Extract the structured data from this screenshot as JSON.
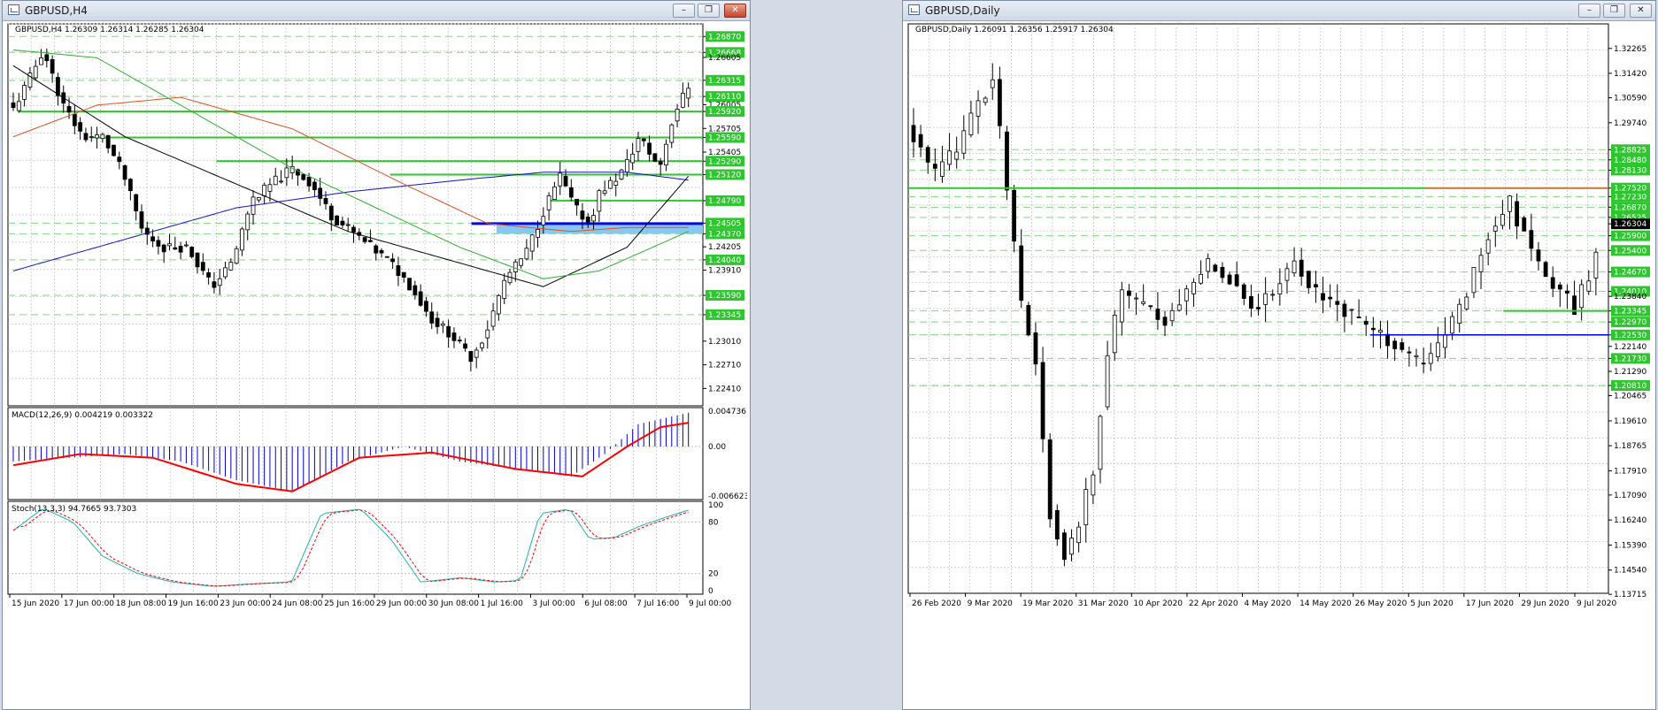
{
  "colors": {
    "bull": "#ffffff",
    "bear": "#000000",
    "grid": "#c0c0c0",
    "green_level": "#2ec62e",
    "dash_level": "#7fd97f",
    "blue": "#0000ff",
    "macd_hist": "#0000cc",
    "macd_signal": "#ff0000",
    "stoch_main": "#20b2aa",
    "stoch_signal": "#ff0000",
    "ma_black": "#000000",
    "ma_blue": "#1010cc",
    "ma_red": "#e05020",
    "ma_green": "#30b030",
    "zone": "#88c8f0",
    "brown": "#c87832"
  },
  "left": {
    "title": "GBPUSD,H4",
    "header": "GBPUSD,H4  1.26309 1.26314 1.26285 1.26304",
    "yrange": [
      1.2219,
      1.2703
    ],
    "yticks": [
      {
        "v": 1.2687,
        "label": "1.26870",
        "hl": true
      },
      {
        "v": 1.26668,
        "label": "1.26668",
        "hl": true
      },
      {
        "v": 1.26605,
        "label": "1.26605",
        "hl": false
      },
      {
        "v": 1.26315,
        "label": "1.26315",
        "hl": true
      },
      {
        "v": 1.2611,
        "label": "1.26110",
        "hl": true
      },
      {
        "v": 1.26005,
        "label": "1.26005",
        "hl": false
      },
      {
        "v": 1.2592,
        "label": "1.25920",
        "hl": true
      },
      {
        "v": 1.25705,
        "label": "1.25705",
        "hl": false
      },
      {
        "v": 1.2559,
        "label": "1.25590",
        "hl": true
      },
      {
        "v": 1.25405,
        "label": "1.25405",
        "hl": false
      },
      {
        "v": 1.2529,
        "label": "1.25290",
        "hl": true
      },
      {
        "v": 1.2512,
        "label": "1.25120",
        "hl": true
      },
      {
        "v": 1.2479,
        "label": "1.24790",
        "hl": true
      },
      {
        "v": 1.24505,
        "label": "1.24505",
        "hl": true
      },
      {
        "v": 1.2437,
        "label": "1.24370",
        "hl": true
      },
      {
        "v": 1.24205,
        "label": "1.24205",
        "hl": false
      },
      {
        "v": 1.2404,
        "label": "1.24040",
        "hl": true
      },
      {
        "v": 1.2391,
        "label": "1.23910",
        "hl": false
      },
      {
        "v": 1.2359,
        "label": "1.23590",
        "hl": true
      },
      {
        "v": 1.23345,
        "label": "1.23345",
        "hl": true
      },
      {
        "v": 1.2301,
        "label": "1.23010",
        "hl": false
      },
      {
        "v": 1.2271,
        "label": "1.22710",
        "hl": false
      },
      {
        "v": 1.2241,
        "label": "1.22410",
        "hl": false
      }
    ],
    "solid_levels": [
      1.2592,
      1.2559,
      1.2529,
      1.2512,
      1.2479
    ],
    "dashed_levels": [
      1.2687,
      1.26668,
      1.26315,
      1.2611,
      1.24505,
      1.2437,
      1.2404,
      1.2359,
      1.23345
    ],
    "blue_level": 1.245,
    "zone": [
      1.2437,
      1.245
    ],
    "xlabels": [
      "15 Jun 2020",
      "17 Jun 00:00",
      "18 Jun 08:00",
      "19 Jun 16:00",
      "23 Jun 00:00",
      "24 Jun 08:00",
      "25 Jun 16:00",
      "29 Jun 00:00",
      "30 Jun 08:00",
      "1 Jul 16:00",
      "3 Jul 00:00",
      "6 Jul 08:00",
      "7 Jul 16:00",
      "9 Jul 00:00"
    ],
    "macd": {
      "header": "MACD(12,26,9) 0.004219 0.003322",
      "range": [
        -0.006623,
        0.004736
      ],
      "ticks": [
        "0.004736",
        "0.00",
        "-0.006623"
      ]
    },
    "stoch": {
      "header": "Stoch(13,3,3) 94.7665 93.7303",
      "ticks": [
        "100",
        "80",
        "20",
        "0"
      ]
    }
  },
  "right": {
    "title": "GBPUSD,Daily",
    "header": "GBPUSD,Daily  1.26091 1.26356 1.25917 1.26304",
    "yrange": [
      1.1375,
      1.331
    ],
    "yticks": [
      {
        "v": 1.32265,
        "label": "1.32265",
        "hl": false
      },
      {
        "v": 1.3142,
        "label": "1.31420",
        "hl": false
      },
      {
        "v": 1.3059,
        "label": "1.30590",
        "hl": false
      },
      {
        "v": 1.2974,
        "label": "1.29740",
        "hl": false
      },
      {
        "v": 1.28825,
        "label": "1.28825",
        "hl": true
      },
      {
        "v": 1.2848,
        "label": "1.28480",
        "hl": true
      },
      {
        "v": 1.2813,
        "label": "1.28130",
        "hl": true
      },
      {
        "v": 1.2752,
        "label": "1.27520",
        "hl": true
      },
      {
        "v": 1.2723,
        "label": "1.27230",
        "hl": true
      },
      {
        "v": 1.2687,
        "label": "1.26870",
        "hl": true
      },
      {
        "v": 1.26525,
        "label": "1.26525",
        "hl": true
      },
      {
        "v": 1.26304,
        "label": "1.26304",
        "hl": false,
        "cur": true
      },
      {
        "v": 1.259,
        "label": "1.25900",
        "hl": true
      },
      {
        "v": 1.254,
        "label": "1.25400",
        "hl": true
      },
      {
        "v": 1.2467,
        "label": "1.24670",
        "hl": true
      },
      {
        "v": 1.2401,
        "label": "1.24010",
        "hl": true
      },
      {
        "v": 1.2384,
        "label": "1.23840",
        "hl": false
      },
      {
        "v": 1.23345,
        "label": "1.23345",
        "hl": true
      },
      {
        "v": 1.2297,
        "label": "1.22970",
        "hl": true
      },
      {
        "v": 1.2253,
        "label": "1.22530",
        "hl": true
      },
      {
        "v": 1.2214,
        "label": "1.22140",
        "hl": false
      },
      {
        "v": 1.2173,
        "label": "1.21730",
        "hl": true
      },
      {
        "v": 1.2129,
        "label": "1.21290",
        "hl": false
      },
      {
        "v": 1.2081,
        "label": "1.20810",
        "hl": true
      },
      {
        "v": 1.20465,
        "label": "1.20465",
        "hl": false
      },
      {
        "v": 1.1961,
        "label": "1.19610",
        "hl": false
      },
      {
        "v": 1.18765,
        "label": "1.18765",
        "hl": false
      },
      {
        "v": 1.1791,
        "label": "1.17910",
        "hl": false
      },
      {
        "v": 1.1709,
        "label": "1.17090",
        "hl": false
      },
      {
        "v": 1.1624,
        "label": "1.16240",
        "hl": false
      },
      {
        "v": 1.1539,
        "label": "1.15390",
        "hl": false
      },
      {
        "v": 1.1454,
        "label": "1.14540",
        "hl": false
      },
      {
        "v": 1.13715,
        "label": "1.13715",
        "hl": false
      }
    ],
    "green_level": 1.2752,
    "brown_segment": 1.2752,
    "blue_level": 1.2253,
    "short_green": 1.23345,
    "dashed_levels": [
      1.28825,
      1.2848,
      1.2813,
      1.2723,
      1.2687,
      1.26525,
      1.259,
      1.254,
      1.2467,
      1.2401,
      1.23345,
      1.2297,
      1.2253,
      1.2173,
      1.2081
    ],
    "xlabels": [
      "26 Feb 2020",
      "9 Mar 2020",
      "19 Mar 2020",
      "31 Mar 2020",
      "10 Apr 2020",
      "22 Apr 2020",
      "4 May 2020",
      "14 May 2020",
      "26 May 2020",
      "5 Jun 2020",
      "17 Jun 2020",
      "29 Jun 2020",
      "9 Jul 2020"
    ]
  }
}
